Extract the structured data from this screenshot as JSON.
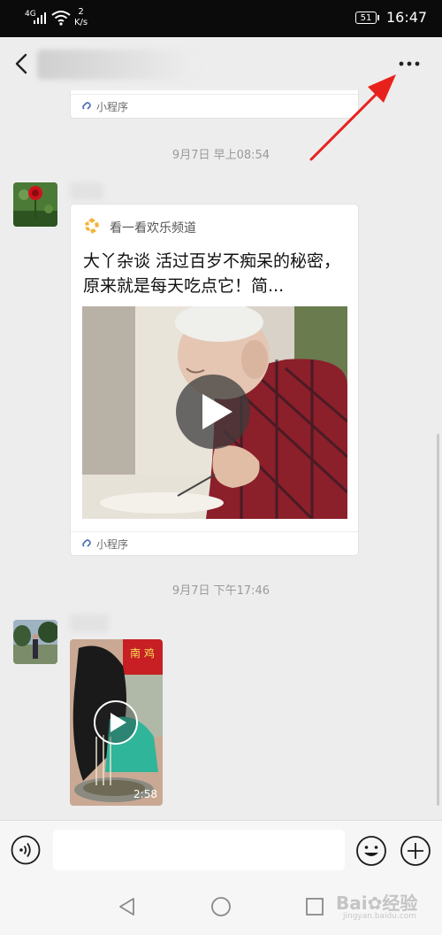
{
  "status": {
    "network": "4G",
    "speed_value": "2",
    "speed_unit": "K/s",
    "battery": "51",
    "time": "16:47"
  },
  "chat": {
    "miniprogram_label": "小程序",
    "messages": [
      {
        "timestamp": "9月7日 早上08:54",
        "card": {
          "source": "看一看欢乐频道",
          "title": "大丫杂谈  活过百岁不痴呆的秘密，原来就是每天吃点它！简..."
        }
      },
      {
        "timestamp": "9月7日 下午17:46",
        "video": {
          "duration": "2:58"
        }
      }
    ]
  },
  "input": {
    "placeholder": ""
  },
  "watermark": {
    "text": "Bai✿经验",
    "sub": "jingyan.baidu.com"
  },
  "colors": {
    "accent_arrow": "#e8211d",
    "miniprogram_icon": "#4a6cb5",
    "source_icon": "#f2b53b"
  }
}
